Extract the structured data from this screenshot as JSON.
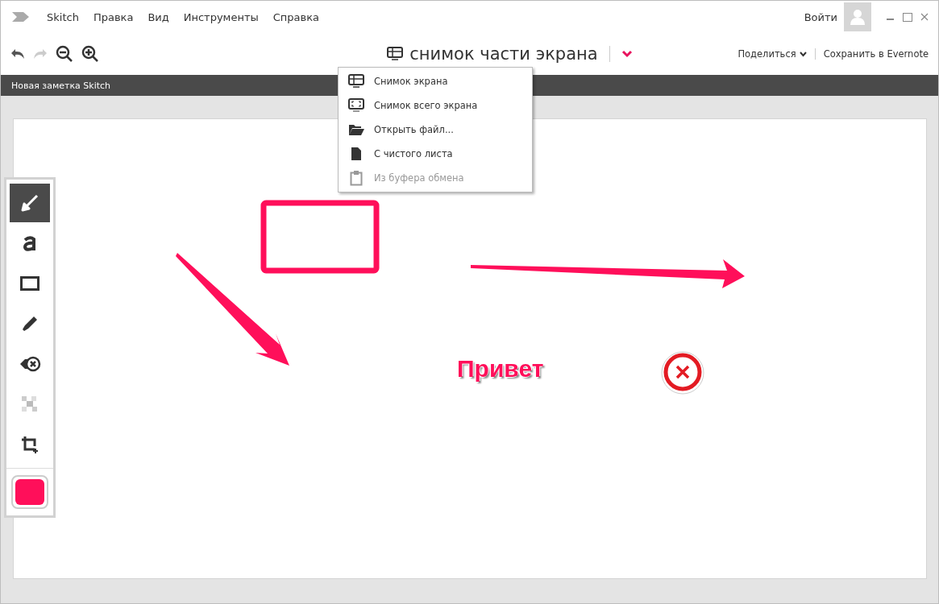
{
  "menu_bar": {
    "app_name": "Skitch",
    "items": [
      "Правка",
      "Вид",
      "Инструменты",
      "Справка"
    ],
    "sign_in": "Войти"
  },
  "toolbar": {
    "capture_title": "снимок части экрана",
    "share": "Поделиться",
    "save": "Сохранить в Evernote"
  },
  "note_bar": {
    "title": "Новая заметка Skitch"
  },
  "capture_menu": [
    {
      "kind": "screen-area",
      "label": "Снимок экрана",
      "disabled": false
    },
    {
      "kind": "full-screen",
      "label": "Снимок всего экрана",
      "disabled": false
    },
    {
      "kind": "open-file",
      "label": "Открыть файл...",
      "disabled": false
    },
    {
      "kind": "blank",
      "label": "С чистого листа",
      "disabled": false
    },
    {
      "kind": "clipboard",
      "label": "Из буфера обмена",
      "disabled": true
    }
  ],
  "tools": [
    {
      "kind": "arrow",
      "selected": true
    },
    {
      "kind": "text",
      "selected": false
    },
    {
      "kind": "rectangle",
      "selected": false
    },
    {
      "kind": "highlighter",
      "selected": false
    },
    {
      "kind": "stamp",
      "selected": false
    },
    {
      "kind": "pixelate",
      "selected": false
    },
    {
      "kind": "crop",
      "selected": false
    }
  ],
  "color_swatch": {
    "color": "#ff0f5a"
  },
  "canvas": {
    "text_annotation": "Привет"
  }
}
